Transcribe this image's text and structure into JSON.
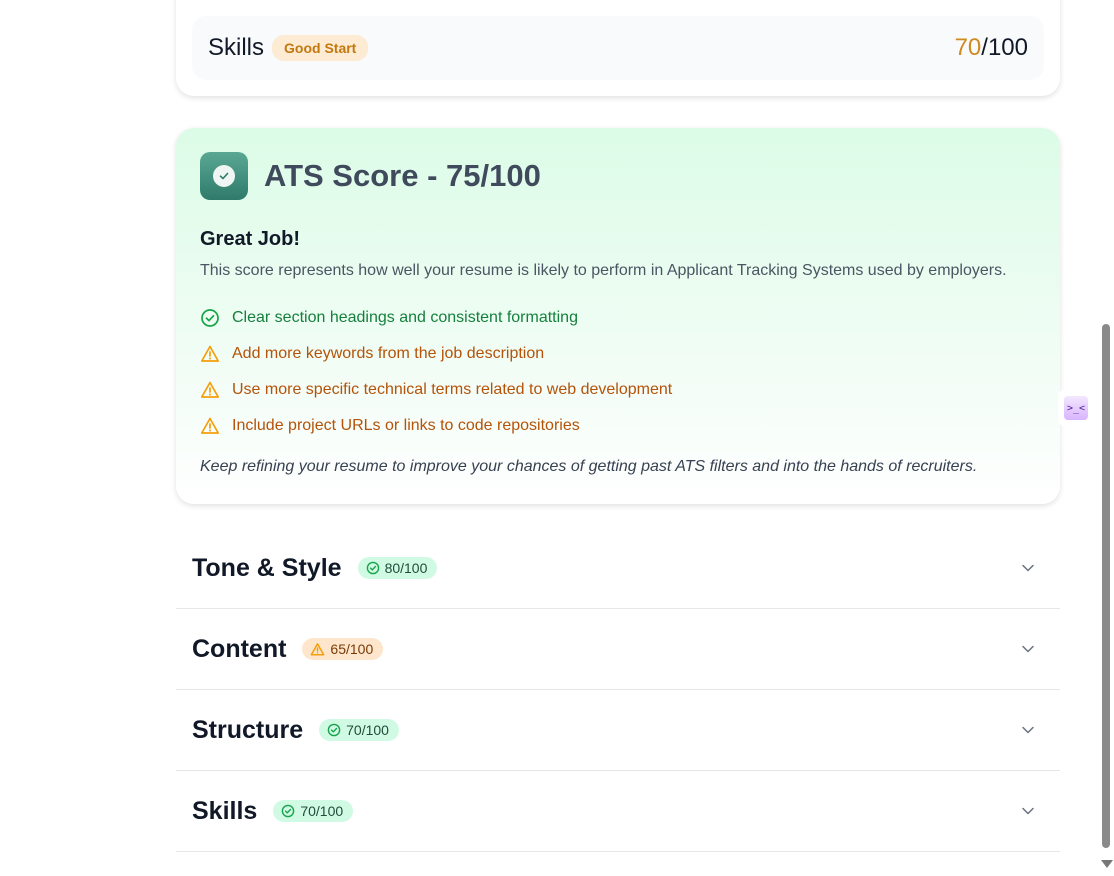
{
  "summary": {
    "title": "Skills",
    "badge": "Good Start",
    "score_value": "70",
    "score_total": "/100"
  },
  "ats": {
    "title": "ATS Score - 75/100",
    "subtitle": "Great Job!",
    "description": "This score represents how well your resume is likely to perform in Applicant Tracking Systems used by employers.",
    "items": [
      {
        "type": "good",
        "icon": "check-circle-icon",
        "text": "Clear section headings and consistent formatting"
      },
      {
        "type": "warn",
        "icon": "warning-icon",
        "text": "Add more keywords from the job description"
      },
      {
        "type": "warn",
        "icon": "warning-icon",
        "text": "Use more specific technical terms related to web development"
      },
      {
        "type": "warn",
        "icon": "warning-icon",
        "text": "Include project URLs or links to code repositories"
      }
    ],
    "note": "Keep refining your resume to improve your chances of getting past ATS filters and into the hands of recruiters."
  },
  "sections": [
    {
      "title": "Tone & Style",
      "score": "80/100",
      "status": "good"
    },
    {
      "title": "Content",
      "score": "65/100",
      "status": "warn"
    },
    {
      "title": "Structure",
      "score": "70/100",
      "status": "good"
    },
    {
      "title": "Skills",
      "score": "70/100",
      "status": "good"
    }
  ],
  "side_widget": {
    "glyph": ">_<"
  },
  "colors": {
    "good": "#15803d",
    "warn": "#b45309",
    "ats_bg": "#dcfce7",
    "warn_badge_bg": "#fde6cc",
    "good_badge_bg": "#d1fae5"
  }
}
